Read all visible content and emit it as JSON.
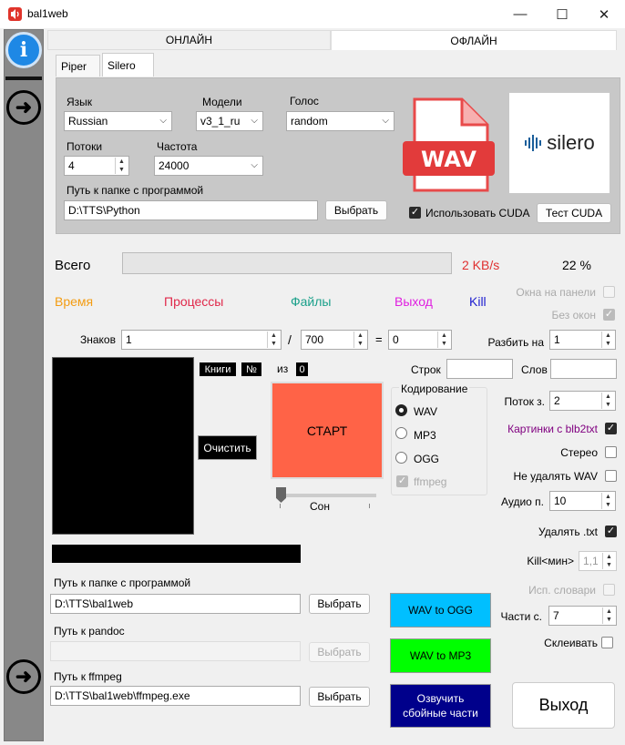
{
  "window": {
    "title": "bal1web",
    "controls": [
      "—",
      "☐",
      "✕"
    ]
  },
  "sidebar": {
    "info_label": "i"
  },
  "tabs": [
    {
      "label": "ОНЛАЙН"
    },
    {
      "label": "ОФЛАЙН"
    }
  ],
  "subtabs": [
    {
      "label": "Piper"
    },
    {
      "label": "Silero"
    }
  ],
  "silero": {
    "language_label": "Язык",
    "language_value": "Russian",
    "models_label": "Модели",
    "models_value": "v3_1_ru",
    "voice_label": "Голос",
    "voice_value": "random",
    "threads_label": "Потоки",
    "threads_value": "4",
    "freq_label": "Частота",
    "freq_value": "24000",
    "path_label": "Путь к папке с программой",
    "path_value": "D:\\TTS\\Python",
    "choose_label": "Выбрать",
    "cuda_label": "Использовать CUDA",
    "cuda_checked": true,
    "test_cuda_label": "Тест CUDA",
    "wav_badge": "WAV",
    "logo_text": "silero"
  },
  "progress": {
    "total_label": "Всего",
    "speed": "2 KB/s",
    "percent": "22 %",
    "fill": 0
  },
  "stats": {
    "time": "Время",
    "processes": "Процессы",
    "files": "Файлы",
    "exit": "Выход",
    "kill": "Kill"
  },
  "chars": {
    "label": "Знаков",
    "from": "1",
    "slash": "/",
    "to": "700",
    "equals": "=",
    "result": "0"
  },
  "books": {
    "books_label": "Книги",
    "num_label": "№",
    "of_label": "из",
    "of_value": "0"
  },
  "clear_label": "Очистить",
  "start_label": "СТАРТ",
  "sleep_label": "Сон",
  "rows_label": "Строк",
  "rows_value": "",
  "words_label": "Слов",
  "words_value": "",
  "encoding": {
    "title": "Кодирование",
    "options": [
      {
        "label": "WAV",
        "selected": true
      },
      {
        "label": "MP3",
        "selected": false
      },
      {
        "label": "OGG",
        "selected": false
      }
    ],
    "ffmpeg_label": "ffmpeg",
    "ffmpeg_checked": true
  },
  "right": {
    "tray_label": "Окна на панели",
    "no_windows_label": "Без окон",
    "split_label": "Разбить на",
    "split_value": "1",
    "stream_label": "Поток з.",
    "stream_value": "2",
    "pictures_label": "Картинки с  blb2txt",
    "stereo_label": "Стерео",
    "keep_wav_label": "Не удалять WAV",
    "audio_label": "Аудио п.",
    "audio_value": "10",
    "delete_txt_label": "Удалять .txt",
    "kill_min_label": "Kill<мин>",
    "kill_min_value": "1,1",
    "dict_label": "Исп. словари",
    "parts_label": "Части с.",
    "parts_value": "7",
    "glue_label": "Склеивать"
  },
  "paths": {
    "program_label": "Путь к папке с программой",
    "program_value": "D:\\TTS\\bal1web",
    "pandoc_label": "Путь к pandoc",
    "pandoc_value": "",
    "ffmpeg_label": "Путь к ffmpeg",
    "ffmpeg_value": "D:\\TTS\\bal1web\\ffmpeg.exe",
    "choose_label": "Выбрать"
  },
  "actions": {
    "wav_ogg": "WAV to OGG",
    "wav_mp3": "WAV to MP3",
    "voice_failed": "Озвучить сбойные части",
    "exit": "Выход"
  },
  "colors": {
    "time": "#f39c12",
    "processes": "#e0284a",
    "files": "#1aa08a",
    "exit": "#e020e0",
    "kill": "#2020d0",
    "speed": "#e03030",
    "start": "#ff6347",
    "ogg": "#00bfff",
    "mp3": "#00ff00",
    "failed": "#00008b",
    "pictures": "#800080"
  }
}
